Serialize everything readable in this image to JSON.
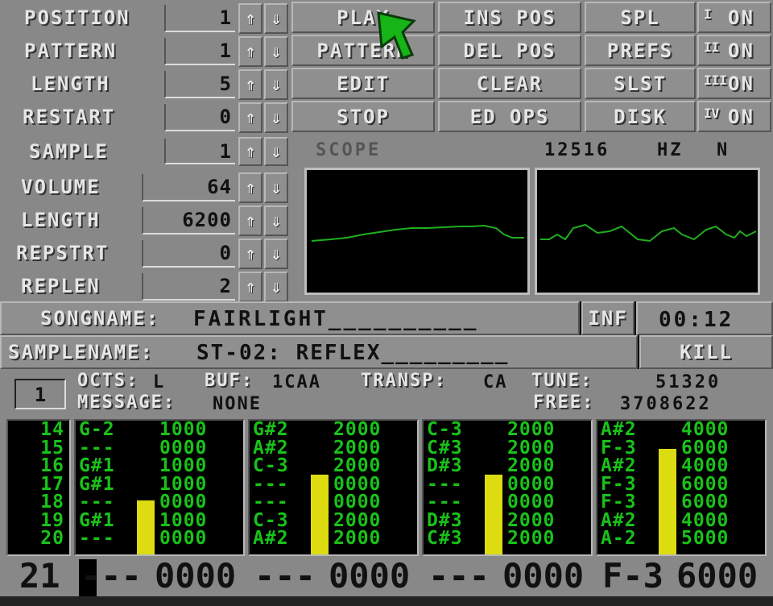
{
  "controls": [
    {
      "label": "POSITION",
      "value": "1"
    },
    {
      "label": "PATTERN",
      "value": "1"
    },
    {
      "label": "LENGTH",
      "value": "5"
    },
    {
      "label": "RESTART",
      "value": "0"
    }
  ],
  "arrows": {
    "up": "⇑",
    "down": "⇓"
  },
  "buttons": {
    "col1": [
      "PLAY",
      "PATTERN",
      "EDIT",
      "STOP"
    ],
    "col2": [
      "INS POS",
      "DEL POS",
      "CLEAR",
      "ED OPS"
    ],
    "col3": [
      "SPL",
      "PREFS",
      "SLST",
      "DISK"
    ],
    "toggles": [
      {
        "roman": "I",
        "state": "ON"
      },
      {
        "roman": "II",
        "state": "ON"
      },
      {
        "roman": "III",
        "state": "ON"
      },
      {
        "roman": "IV",
        "state": "ON"
      }
    ]
  },
  "sample": {
    "label": "SAMPLE",
    "value": "1"
  },
  "sample_params": [
    {
      "label": "VOLUME",
      "value": "64"
    },
    {
      "label": "LENGTH",
      "value": "6200"
    },
    {
      "label": "REPSTRT",
      "value": "0"
    },
    {
      "label": "REPLEN",
      "value": "2"
    }
  ],
  "scope": {
    "label": "SCOPE",
    "frequency": "12516",
    "unit": "HZ",
    "mode": "N"
  },
  "song": {
    "label": "SONGNAME:",
    "name": "FAIRLIGHT__________",
    "info_button": "INF",
    "time": "00:12"
  },
  "samplename": {
    "label": "SAMPLENAME:",
    "name": "ST-02: REFLEX_________",
    "kill_button": "KILL"
  },
  "status": {
    "track_number": "1",
    "octs_label": "OCTS:",
    "octs_value": "L",
    "buf_label": "BUF:",
    "buf_value": "1CAA",
    "transp_label": "TRANSP:",
    "transp_value": "CA",
    "tune_label": "TUNE:",
    "tune_value": "51320",
    "message_label": "MESSAGE:",
    "message_value": "NONE",
    "free_label": "FREE:",
    "free_value": "3708622"
  },
  "pattern": {
    "row_numbers": [
      "14",
      "15",
      "16",
      "17",
      "18",
      "19",
      "20"
    ],
    "tracks": [
      {
        "rows": [
          [
            "G-2",
            "1000"
          ],
          [
            "---",
            "0000"
          ],
          [
            "G#1",
            "1000"
          ],
          [
            "G#1",
            "1000"
          ],
          [
            "---",
            "0000"
          ],
          [
            "G#1",
            "1000"
          ],
          [
            "---",
            "0000"
          ]
        ],
        "vu_level": 0.42
      },
      {
        "rows": [
          [
            "G#2",
            "2000"
          ],
          [
            "A#2",
            "2000"
          ],
          [
            "C-3",
            "2000"
          ],
          [
            "---",
            "0000"
          ],
          [
            "---",
            "0000"
          ],
          [
            "C-3",
            "2000"
          ],
          [
            "A#2",
            "2000"
          ]
        ],
        "vu_level": 0.62
      },
      {
        "rows": [
          [
            "C-3",
            "2000"
          ],
          [
            "C#3",
            "2000"
          ],
          [
            "D#3",
            "2000"
          ],
          [
            "---",
            "0000"
          ],
          [
            "---",
            "0000"
          ],
          [
            "D#3",
            "2000"
          ],
          [
            "C#3",
            "2000"
          ]
        ],
        "vu_level": 0.62
      },
      {
        "rows": [
          [
            "A#2",
            "4000"
          ],
          [
            "F-3",
            "6000"
          ],
          [
            "A#2",
            "4000"
          ],
          [
            "F-3",
            "6000"
          ],
          [
            "F-3",
            "6000"
          ],
          [
            "A#2",
            "4000"
          ],
          [
            "A-2",
            "5000"
          ]
        ],
        "vu_level": 0.82
      }
    ],
    "current_row": "21",
    "current": [
      [
        "---",
        "0000"
      ],
      [
        "---",
        "0000"
      ],
      [
        "---",
        "0000"
      ],
      [
        "F-3",
        "6000"
      ]
    ]
  },
  "colors": {
    "panel": "#888888",
    "text_light": "#e6e6e6",
    "pattern_green": "#19c219",
    "vu_yellow": "#dcdc10",
    "scope_wave": "#1fae1f"
  }
}
